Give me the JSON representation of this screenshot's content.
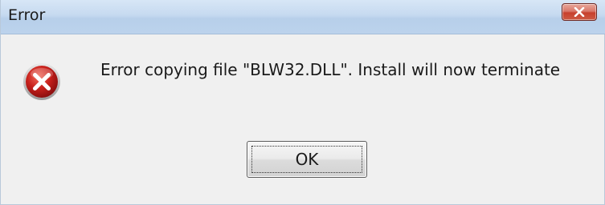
{
  "window": {
    "title": "Error"
  },
  "titlebar": {
    "close_icon": "close-x-icon"
  },
  "dialog": {
    "icon": "error-icon",
    "message": "Error copying file \"BLW32.DLL\".  Install will now terminate",
    "ok_label": "OK"
  },
  "colors": {
    "titlebar": "#c6daf0",
    "body": "#f0f0f0",
    "close_button": "#c7402d",
    "error_icon": "#c8211c"
  }
}
